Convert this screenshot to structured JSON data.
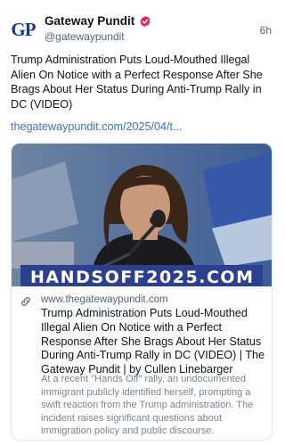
{
  "author": {
    "avatar_text": "GP",
    "name": "Gateway Pundit",
    "handle": "@gatewaypundit"
  },
  "post": {
    "timestamp": "6h",
    "text": "Trump Administration Puts Loud-Mouthed Illegal Alien On Notice with a Perfect Response After She Brags About Her Status During Anti-Trump Rally in DC (VIDEO)",
    "link_text": "thegatewaypundit.com/2025/04/t..."
  },
  "card": {
    "banner_text": "HANDSOFF2025.COM",
    "domain": "www.thegatewaypundit.com",
    "title": "Trump Administration Puts Loud-Mouthed Illegal Alien On Notice with a Perfect Response After She Brags About Her Status During Anti-Trump Rally in DC (VIDEO) | The Gateway Pundit | by Cullen Linebarger",
    "description": "At a recent \"Hands Off\" rally, an undocumented immigrant publicly identified herself, prompting a swift reaction from the Trump administration. The incident raises significant questions about immigration policy and public discourse."
  },
  "icons": {
    "verified": "verified-badge-icon",
    "link": "link-icon"
  },
  "colors": {
    "link": "#3b6fd4",
    "verified": "#e0245e",
    "banner": "#2d3f8f"
  }
}
